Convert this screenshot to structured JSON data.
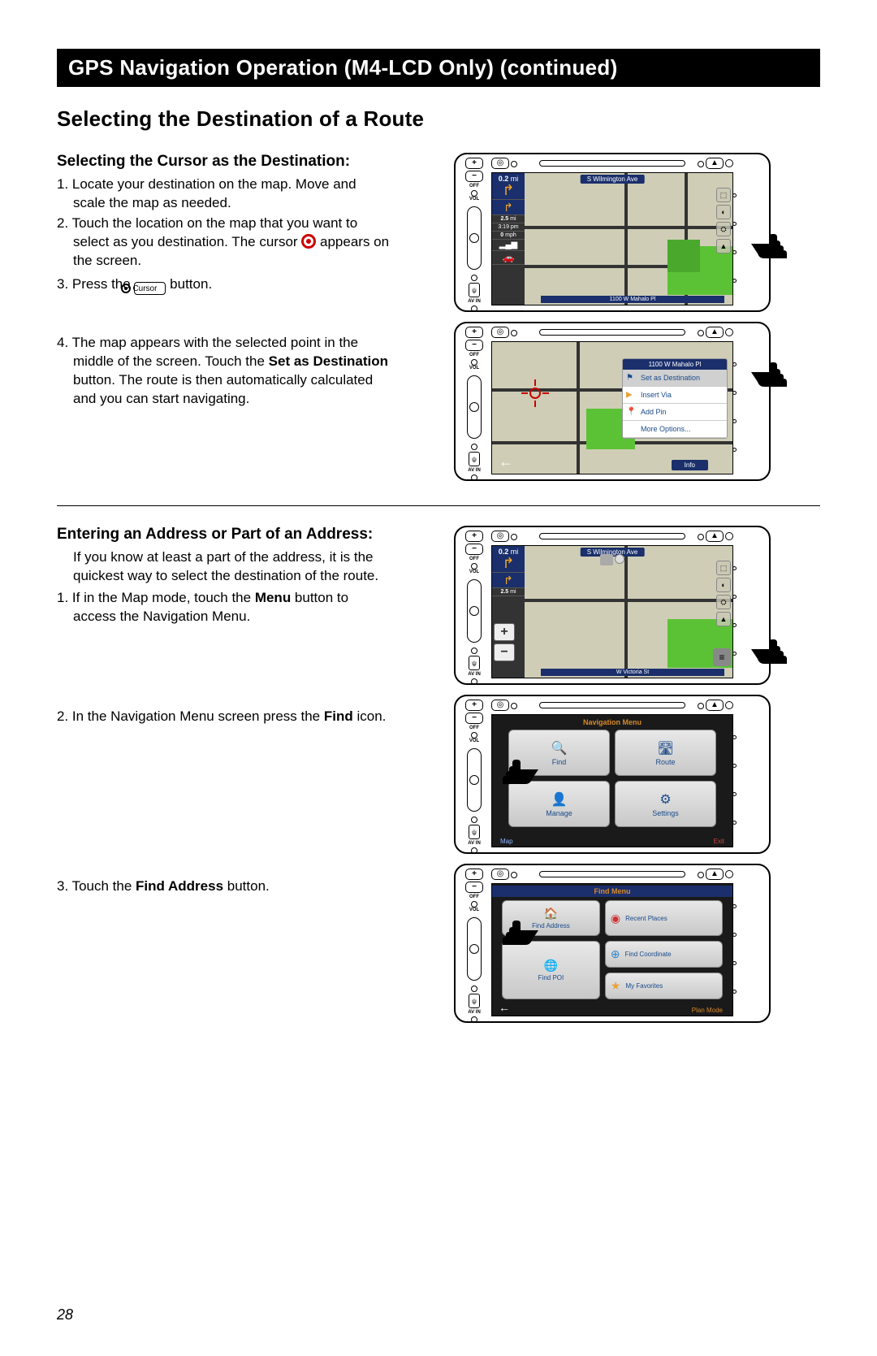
{
  "title_bar": "GPS Navigation Operation (M4-LCD Only) (continued)",
  "section_heading": "Selecting the Destination of a Route",
  "page_number": "28",
  "sec1": {
    "heading": "Selecting the Cursor as the Destination:",
    "step1": "1. Locate your destination on the map. Move and scale the map as needed.",
    "step2a": "2. Touch the location on the map that you want to select as you destination. The cursor ",
    "step2b": " appears on the screen.",
    "step3a": "3. Press the ",
    "step3_btn": "Cursor",
    "step3b": " button.",
    "step4a": "4. The map appears with the selected point in the middle of the screen. Touch the ",
    "step4_bold": "Set as Destination",
    "step4b": " button. The route is then automatically calculated and you can start navigating."
  },
  "sec2": {
    "heading": "Entering an Address or Part of an Address:",
    "intro": "If you know at least a part of the address, it is the quickest way to select the destination of the route.",
    "step1a": "1. If in the Map mode, touch the ",
    "step1_bold": "Menu",
    "step1b": " button to access the Navigation Menu.",
    "step2a": "2. In the Navigation Menu screen press the ",
    "step2_bold": "Find",
    "step2b": " icon.",
    "step3a": "3. Touch the ",
    "step3_bold": "Find Address",
    "step3b": " button."
  },
  "screens": {
    "s1": {
      "street": "S Wilmington Ave",
      "dist1": "0.2",
      "dist1_unit": "mi",
      "dist2": "2.5",
      "dist2_unit": "mi",
      "time": "3:19 pm",
      "speed": "0",
      "speed_unit": "mph",
      "bottom": "1100 W Mahalo Pl"
    },
    "s2": {
      "header": "1100 W Mahalo Pl",
      "menu": [
        "Set as Destination",
        "Insert Via",
        "Add Pin",
        "More Options..."
      ],
      "info": "Info"
    },
    "s3": {
      "street": "S Wilmington Ave",
      "dist1": "0.2",
      "dist1_unit": "mi",
      "dist2": "2.5",
      "dist2_unit": "mi",
      "bottom": "W Victoria St"
    },
    "s4": {
      "title": "Navigation Menu",
      "tiles": [
        "Find",
        "Route",
        "Manage",
        "Settings"
      ],
      "map": "Map",
      "exit": "Exit"
    },
    "s5": {
      "title": "Find Menu",
      "find_address": "Find Address",
      "find_poi": "Find POI",
      "recent": "Recent Places",
      "coord": "Find Coordinate",
      "fav": "My Favorites",
      "plan": "Plan Mode"
    }
  }
}
